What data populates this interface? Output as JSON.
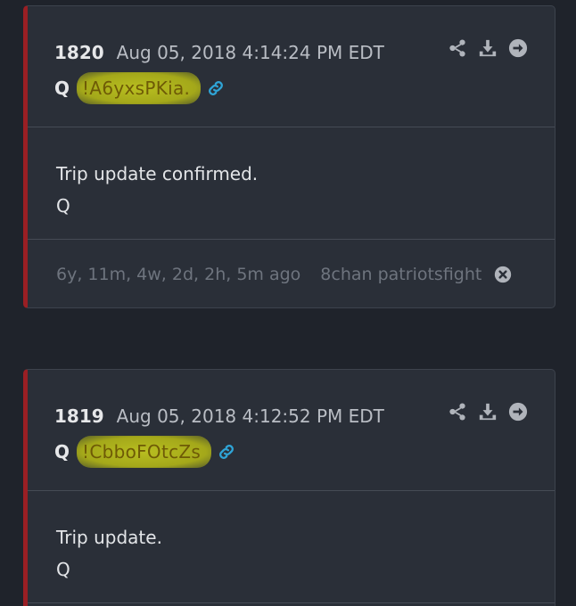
{
  "posts": [
    {
      "number": "1820",
      "timestamp": "Aug 05, 2018 4:14:24 PM EDT",
      "author": "Q",
      "tripcode": "!A6yxsPKia.",
      "message": [
        "Trip update confirmed.",
        "Q"
      ],
      "age": "6y, 11m, 4w, 2d, 2h, 5m ago",
      "source": "8chan patriotsfight"
    },
    {
      "number": "1819",
      "timestamp": "Aug 05, 2018 4:12:52 PM EDT",
      "author": "Q",
      "tripcode": "!CbboFOtcZs",
      "message": [
        "Trip update.",
        "Q"
      ]
    }
  ],
  "icons": {
    "share": "share-icon",
    "download": "download-icon",
    "open": "arrow-right-circle-icon",
    "link": "link-icon",
    "close": "close-circle-icon"
  },
  "colors": {
    "background": "#1f232b",
    "card": "#2a2f38",
    "accent_border": "#9a1f24",
    "highlight": "#b0b51d",
    "link_icon": "#2fa4d6",
    "action_icons": "#b0b4bb"
  }
}
